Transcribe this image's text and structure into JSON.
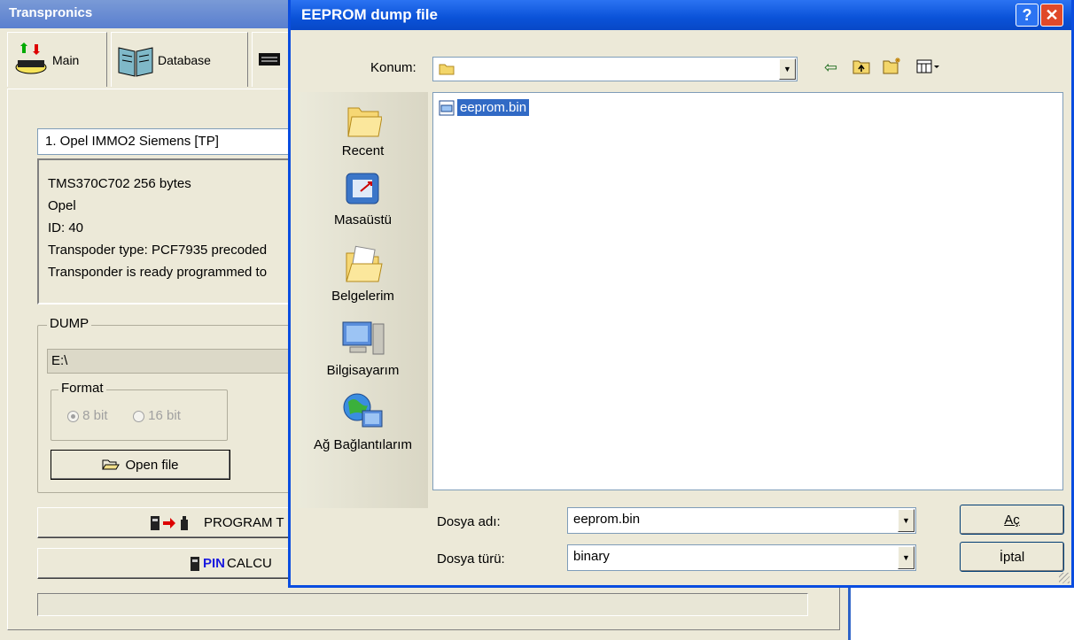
{
  "main_window": {
    "title": "Transpronics",
    "tabs": [
      {
        "label": "Main",
        "icon": "chip-icon"
      },
      {
        "label": "Database",
        "icon": "book-icon"
      }
    ],
    "selected_car": "1. Opel IMMO2 Siemens [TP]",
    "info_lines": [
      "TMS370C702  256 bytes",
      "Opel",
      "ID: 40",
      "Transpoder type: PCF7935 precoded",
      "Transponder is ready programmed to"
    ],
    "dump": {
      "legend": "DUMP",
      "path": "E:\\",
      "format_legend": "Format",
      "format_8": "8 bit",
      "format_16": "16 bit",
      "open_file": "Open file"
    },
    "program_button": "PROGRAM T",
    "pin_prefix": "PIN",
    "pin_suffix": " CALCU"
  },
  "dialog": {
    "title": "EEPROM dump file",
    "look_in_label": "Konum:",
    "look_in_value": "",
    "places": [
      "Recent",
      "Masaüstü",
      "Belgelerim",
      "Bilgisayarım",
      "Ağ Bağlantılarım"
    ],
    "files": [
      "eeprom.bin"
    ],
    "filename_label": "Dosya adı:",
    "filename_value": "eeprom.bin",
    "filetype_label": "Dosya türü:",
    "filetype_value": "binary",
    "open_button": "Aç",
    "cancel_button": "İptal"
  }
}
